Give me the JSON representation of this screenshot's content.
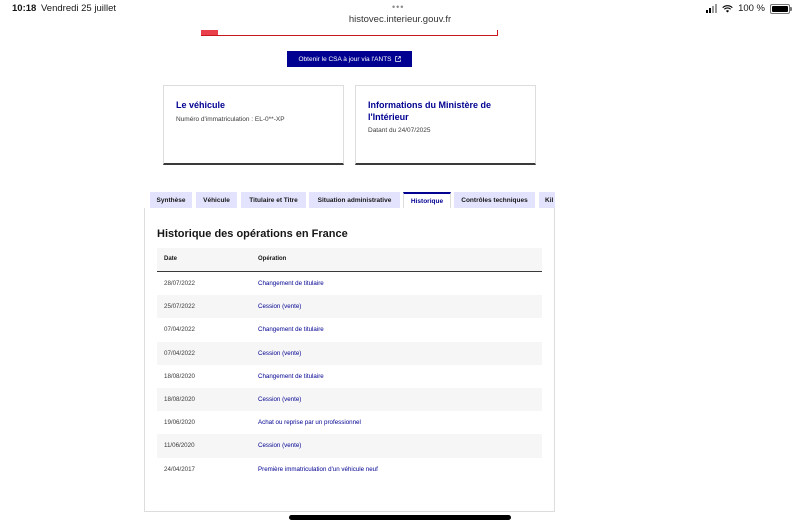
{
  "statusbar": {
    "time": "10:18",
    "date": "Vendredi 25 juillet",
    "dots": "•••",
    "url": "histovec.interieur.gouv.fr",
    "battery_percent": "100 %"
  },
  "ants_button": {
    "label": "Obtenir le CSA à jour via l'ANTS",
    "icon": "external-link-icon"
  },
  "cards": [
    {
      "title": "Le véhicule",
      "subtitle": "Numéro d'immatriculation : EL-0**-XP"
    },
    {
      "title": "Informations du Ministère de l'Intérieur",
      "subtitle": "Datant du 24/07/2025"
    }
  ],
  "tabs": [
    {
      "label": "Synthèse"
    },
    {
      "label": "Véhicule"
    },
    {
      "label": "Titulaire et Titre"
    },
    {
      "label": "Situation administrative"
    },
    {
      "label": "Historique"
    },
    {
      "label": "Contrôles techniques"
    },
    {
      "label": "Kil"
    }
  ],
  "active_tab": "Historique",
  "history": {
    "title": "Historique des opérations en France",
    "columns": {
      "date": "Date",
      "operation": "Opération"
    },
    "rows": [
      {
        "date": "28/07/2022",
        "operation": "Changement de titulaire"
      },
      {
        "date": "25/07/2022",
        "operation": "Cession (vente)"
      },
      {
        "date": "07/04/2022",
        "operation": "Changement de titulaire"
      },
      {
        "date": "07/04/2022",
        "operation": "Cession (vente)"
      },
      {
        "date": "18/08/2020",
        "operation": "Changement de titulaire"
      },
      {
        "date": "18/08/2020",
        "operation": "Cession (vente)"
      },
      {
        "date": "19/06/2020",
        "operation": "Achat ou reprise par un professionnel"
      },
      {
        "date": "11/06/2020",
        "operation": "Cession (vente)"
      },
      {
        "date": "24/04/2017",
        "operation": "Première immatriculation d'un véhicule neuf"
      }
    ]
  },
  "colors": {
    "accent": "#000091",
    "tab_bg": "#e3e3fd",
    "row_alt": "#f6f6f6"
  }
}
